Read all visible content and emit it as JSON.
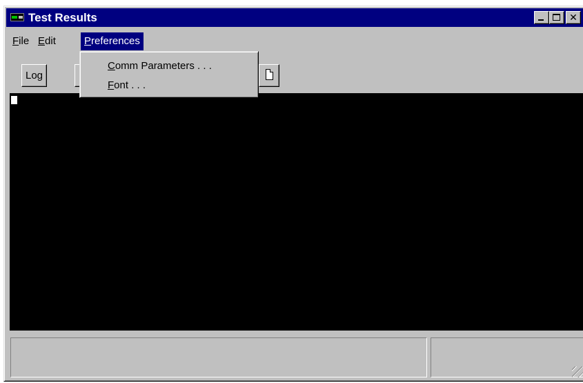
{
  "window": {
    "title": "Test Results",
    "icon": "terminal-app-icon",
    "controls": [
      "minimize",
      "maximize",
      "close"
    ]
  },
  "menubar": {
    "file": {
      "hotkey": "F",
      "rest": "ile"
    },
    "edit": {
      "hotkey": "E",
      "rest": "dit"
    },
    "preferences": {
      "hotkey": "P",
      "rest": "references"
    }
  },
  "preferences_menu": {
    "items": [
      {
        "hotkey": "C",
        "rest": "omm Parameters . . ."
      },
      {
        "hotkey": "F",
        "rest": "ont . . ."
      }
    ]
  },
  "toolbar": {
    "log_label": "Log"
  },
  "colors": {
    "titlebar": "#000080",
    "face": "#c0c0c0",
    "terminal_bg": "#000000",
    "menu_highlight": "#000080"
  }
}
